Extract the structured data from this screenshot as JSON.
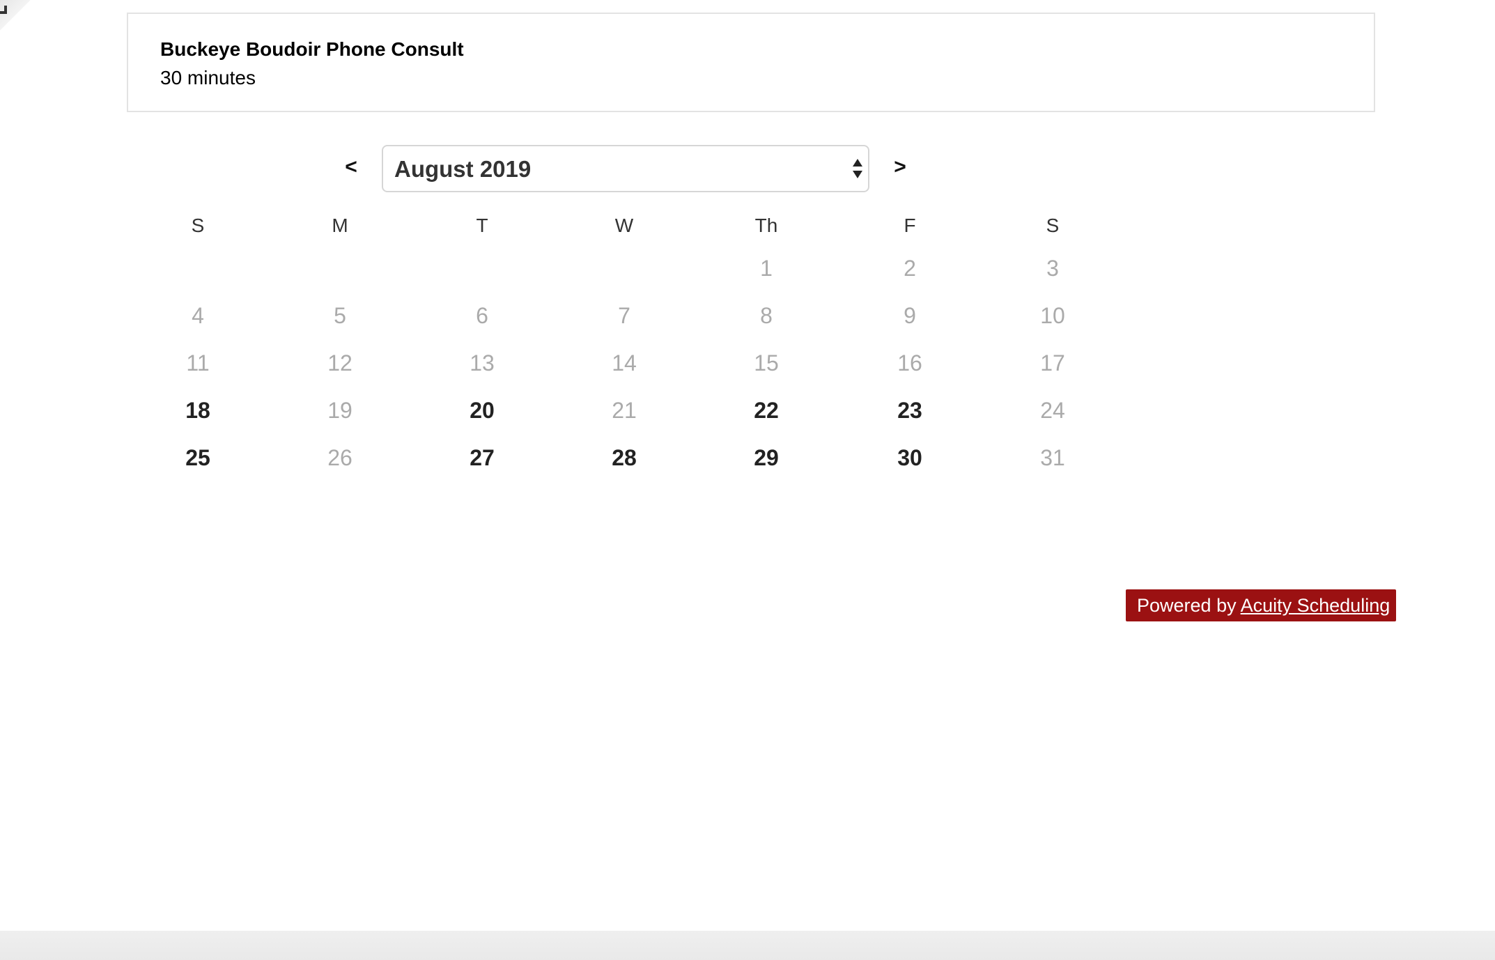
{
  "appointment": {
    "title": "Buckeye Boudoir Phone Consult",
    "duration": "30 minutes"
  },
  "calendar": {
    "prev_label": "<",
    "next_label": ">",
    "month_selected": "August 2019",
    "weekdays": [
      "S",
      "M",
      "T",
      "W",
      "Th",
      "F",
      "S"
    ],
    "weeks": [
      [
        null,
        null,
        null,
        null,
        {
          "day": "1",
          "available": false
        },
        {
          "day": "2",
          "available": false
        },
        {
          "day": "3",
          "available": false
        }
      ],
      [
        {
          "day": "4",
          "available": false
        },
        {
          "day": "5",
          "available": false
        },
        {
          "day": "6",
          "available": false
        },
        {
          "day": "7",
          "available": false
        },
        {
          "day": "8",
          "available": false
        },
        {
          "day": "9",
          "available": false
        },
        {
          "day": "10",
          "available": false
        }
      ],
      [
        {
          "day": "11",
          "available": false
        },
        {
          "day": "12",
          "available": false
        },
        {
          "day": "13",
          "available": false
        },
        {
          "day": "14",
          "available": false
        },
        {
          "day": "15",
          "available": false
        },
        {
          "day": "16",
          "available": false
        },
        {
          "day": "17",
          "available": false
        }
      ],
      [
        {
          "day": "18",
          "available": true
        },
        {
          "day": "19",
          "available": false
        },
        {
          "day": "20",
          "available": true
        },
        {
          "day": "21",
          "available": false
        },
        {
          "day": "22",
          "available": true
        },
        {
          "day": "23",
          "available": true
        },
        {
          "day": "24",
          "available": false
        }
      ],
      [
        {
          "day": "25",
          "available": true
        },
        {
          "day": "26",
          "available": false
        },
        {
          "day": "27",
          "available": true
        },
        {
          "day": "28",
          "available": true
        },
        {
          "day": "29",
          "available": true
        },
        {
          "day": "30",
          "available": true
        },
        {
          "day": "31",
          "available": false
        }
      ]
    ]
  },
  "footer": {
    "powered_prefix": "Powered by ",
    "powered_link": "Acuity Scheduling"
  },
  "colors": {
    "badge_background": "#9b1112",
    "available_day": "#222222",
    "unavailable_day": "#aaaaaa"
  }
}
